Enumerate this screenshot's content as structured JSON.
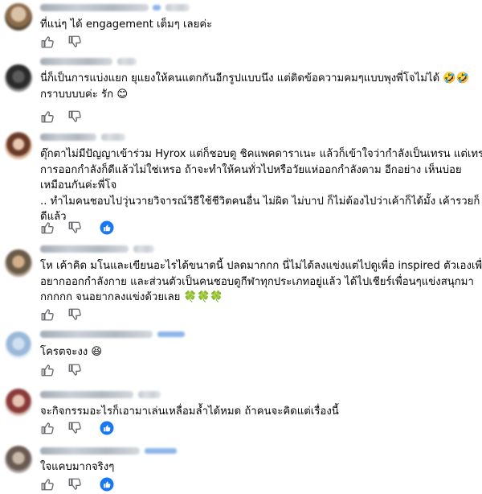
{
  "comments": [
    {
      "lines": [
        "ที่แน่ๆ ได้ engagement เต็มๆ เลยค่ะ"
      ],
      "has_reaction": false
    },
    {
      "lines": [
        "นี่ก็เป็นการแบ่งแยก ยุแยงให้คนแตกกันอีกรูปแบบนึง แต่ติดข้อความคมๆแบบพุงพี่โจไม่ได้ 🤣🤣",
        "กราบบบบค่ะ รัก 😊"
      ],
      "has_reaction": false
    },
    {
      "lines": [
        "ตุ๊กตาไม่มีปัญญาเข้าร่วม Hyrox แต่ก็ชอบดู ชิคแพคดาราเนะ แล้วก็เข้าใจว่ากำลังเป็นเทรน แต่เทรน",
        "การออกกำลังก็ดีแล้วไม่ใช่เหรอ ถ้าจะทำให้คนทั่วไปหรือวัยแห่ออกกำลังตาม อีกอย่าง เห็นบ่อย",
        "เหมือนกันค่ะพี่โจ",
        ".. ทำไมคนชอบไปวุ่นวายวิจารณ์วิธีใช้ชีวิตคนอื่น ไม่ผิด ไม่บาป ก็ไม่ต้องไปว่าเค้าก็ได้มั้ง เค้ารวยก็",
        "ดีแล้ว"
      ],
      "has_reaction": true
    },
    {
      "lines": [
        "โห เค้าคิด มโนและเขียนอะไรได้ขนาดนี้ ปลดมากกก นี่ไม่ได้ลงแข่งแต่ไปดูเพื่อ inspired ตัวเองเพื่อ",
        "อยากออกกำลังกาย และส่วนตัวเป็นคนชอบดูกีฬาทุกประเภทอยู่แล้ว ได้ไปเชียร์เพื่อนๆแข่งสนุกมา",
        "กกกกก จนอยากลงแข่งด้วยเลย 🍀🍀🍀"
      ],
      "has_reaction": false
    },
    {
      "lines": [
        "โครตจะงง 😆"
      ],
      "has_reaction": false
    },
    {
      "lines": [
        "จะกิจกรรมอะไรก็เอามาเล่นเหลื่อมล้ำได้หมด ถ้าคนจะคิดแต่เรื่องนี้"
      ],
      "has_reaction": true
    },
    {
      "lines": [
        "ใจแคบมากจริงๆ"
      ],
      "has_reaction": true
    }
  ],
  "icons": {
    "like": "thumbs-up-icon",
    "dislike": "thumbs-down-icon",
    "reaction": "like-reaction-icon"
  },
  "colors": {
    "accent": "#1877f2",
    "icon_gray": "#65676b"
  }
}
